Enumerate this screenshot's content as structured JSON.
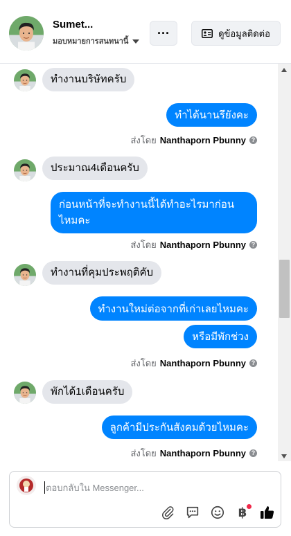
{
  "header": {
    "name": "Sumet...",
    "assign_label": "มอบหมายการสนทนานี้",
    "more_label": "···",
    "contact_label": "ดูข้อมูลติดต่อ"
  },
  "messages": [
    {
      "from": "customer",
      "text": "ทำงานบริษัทครับ"
    },
    {
      "from": "page",
      "text": "ทำได้นานรึยังคะ"
    },
    {
      "from": "page_meta",
      "sent_prefix": "ส่งโดย",
      "sender": "Nanthaporn Pbunny"
    },
    {
      "from": "customer",
      "text": "ประมาณ4เดือนครับ"
    },
    {
      "from": "page",
      "text": "ก่อนหน้าที่จะทำงานนี้ได้ทำอะไรมาก่อนไหมคะ"
    },
    {
      "from": "page_meta",
      "sent_prefix": "ส่งโดย",
      "sender": "Nanthaporn Pbunny"
    },
    {
      "from": "customer",
      "text": "ทำงานที่คุมประพฤติคับ"
    },
    {
      "from": "page",
      "text": "ทำงานใหม่ต่อจากที่เก่าเลยไหมคะ"
    },
    {
      "from": "page",
      "text": "หรือมีพักช่วง"
    },
    {
      "from": "page_meta",
      "sent_prefix": "ส่งโดย",
      "sender": "Nanthaporn Pbunny"
    },
    {
      "from": "customer",
      "text": "พักได้1เดือนครับ"
    },
    {
      "from": "page",
      "text": "ลูกค้ามีประกันสังคมด้วยไหมคะ"
    },
    {
      "from": "page_meta",
      "sent_prefix": "ส่งโดย",
      "sender": "Nanthaporn Pbunny"
    }
  ],
  "composer": {
    "placeholder": "ตอบกลับใน Messenger...",
    "value": "",
    "tools": [
      "paperclip-icon",
      "chat-bubble-icon",
      "emoji-icon",
      "baht-payment-icon",
      "thumbs-up-icon"
    ],
    "baht_symbol": "฿"
  },
  "colors": {
    "outgoing_bubble": "#0084ff",
    "incoming_bubble": "#e4e6eb",
    "notification_dot": "#f02849",
    "like_icon": "#050505"
  }
}
